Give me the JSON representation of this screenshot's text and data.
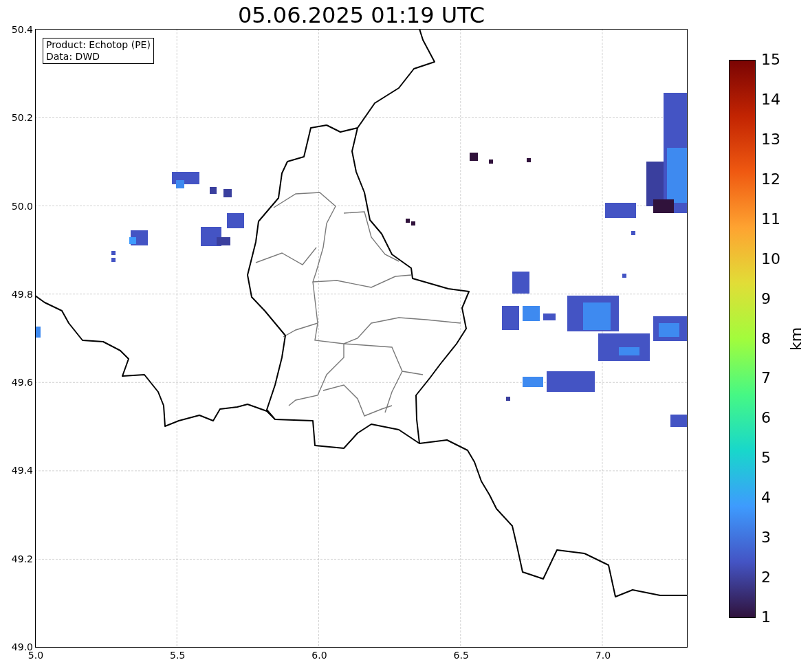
{
  "title": "05.06.2025 01:19 UTC",
  "info_box": [
    "Product: Echotop (PE)",
    "Data: DWD"
  ],
  "map": {
    "y_ticks": [
      "50.4",
      "50.2",
      "50.0",
      "49.8",
      "49.6",
      "49.4",
      "49.2",
      "49.0"
    ],
    "x_ticks": [
      "5.0",
      "5.5",
      "6.0",
      "6.5",
      "7.0"
    ]
  },
  "colorbar": {
    "ticks": [
      "15",
      "14",
      "13",
      "12",
      "11",
      "10",
      "9",
      "8",
      "7",
      "6",
      "5",
      "4",
      "3",
      "2",
      "1"
    ],
    "label": "km"
  }
}
